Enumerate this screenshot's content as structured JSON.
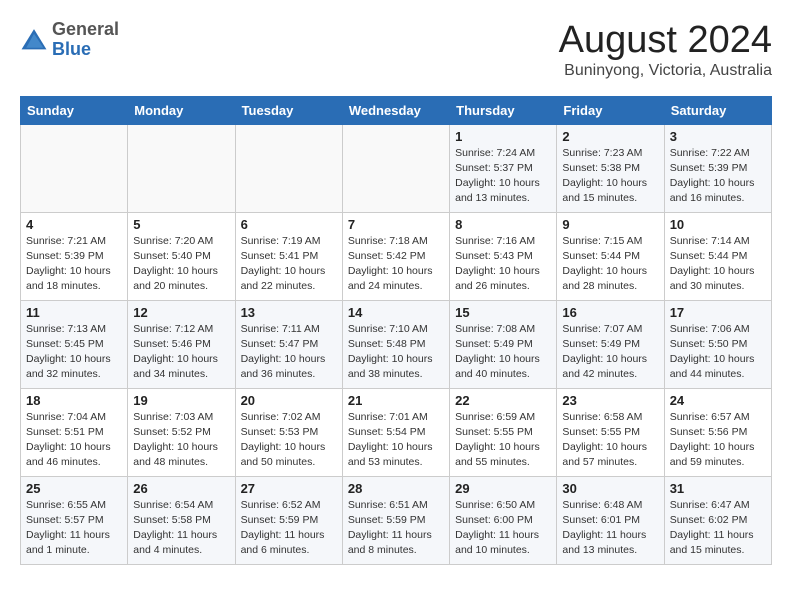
{
  "header": {
    "logo_general": "General",
    "logo_blue": "Blue",
    "title": "August 2024",
    "subtitle": "Buninyong, Victoria, Australia"
  },
  "days_of_week": [
    "Sunday",
    "Monday",
    "Tuesday",
    "Wednesday",
    "Thursday",
    "Friday",
    "Saturday"
  ],
  "weeks": [
    [
      {
        "day": "",
        "info": ""
      },
      {
        "day": "",
        "info": ""
      },
      {
        "day": "",
        "info": ""
      },
      {
        "day": "",
        "info": ""
      },
      {
        "day": "1",
        "info": "Sunrise: 7:24 AM\nSunset: 5:37 PM\nDaylight: 10 hours\nand 13 minutes."
      },
      {
        "day": "2",
        "info": "Sunrise: 7:23 AM\nSunset: 5:38 PM\nDaylight: 10 hours\nand 15 minutes."
      },
      {
        "day": "3",
        "info": "Sunrise: 7:22 AM\nSunset: 5:39 PM\nDaylight: 10 hours\nand 16 minutes."
      }
    ],
    [
      {
        "day": "4",
        "info": "Sunrise: 7:21 AM\nSunset: 5:39 PM\nDaylight: 10 hours\nand 18 minutes."
      },
      {
        "day": "5",
        "info": "Sunrise: 7:20 AM\nSunset: 5:40 PM\nDaylight: 10 hours\nand 20 minutes."
      },
      {
        "day": "6",
        "info": "Sunrise: 7:19 AM\nSunset: 5:41 PM\nDaylight: 10 hours\nand 22 minutes."
      },
      {
        "day": "7",
        "info": "Sunrise: 7:18 AM\nSunset: 5:42 PM\nDaylight: 10 hours\nand 24 minutes."
      },
      {
        "day": "8",
        "info": "Sunrise: 7:16 AM\nSunset: 5:43 PM\nDaylight: 10 hours\nand 26 minutes."
      },
      {
        "day": "9",
        "info": "Sunrise: 7:15 AM\nSunset: 5:44 PM\nDaylight: 10 hours\nand 28 minutes."
      },
      {
        "day": "10",
        "info": "Sunrise: 7:14 AM\nSunset: 5:44 PM\nDaylight: 10 hours\nand 30 minutes."
      }
    ],
    [
      {
        "day": "11",
        "info": "Sunrise: 7:13 AM\nSunset: 5:45 PM\nDaylight: 10 hours\nand 32 minutes."
      },
      {
        "day": "12",
        "info": "Sunrise: 7:12 AM\nSunset: 5:46 PM\nDaylight: 10 hours\nand 34 minutes."
      },
      {
        "day": "13",
        "info": "Sunrise: 7:11 AM\nSunset: 5:47 PM\nDaylight: 10 hours\nand 36 minutes."
      },
      {
        "day": "14",
        "info": "Sunrise: 7:10 AM\nSunset: 5:48 PM\nDaylight: 10 hours\nand 38 minutes."
      },
      {
        "day": "15",
        "info": "Sunrise: 7:08 AM\nSunset: 5:49 PM\nDaylight: 10 hours\nand 40 minutes."
      },
      {
        "day": "16",
        "info": "Sunrise: 7:07 AM\nSunset: 5:49 PM\nDaylight: 10 hours\nand 42 minutes."
      },
      {
        "day": "17",
        "info": "Sunrise: 7:06 AM\nSunset: 5:50 PM\nDaylight: 10 hours\nand 44 minutes."
      }
    ],
    [
      {
        "day": "18",
        "info": "Sunrise: 7:04 AM\nSunset: 5:51 PM\nDaylight: 10 hours\nand 46 minutes."
      },
      {
        "day": "19",
        "info": "Sunrise: 7:03 AM\nSunset: 5:52 PM\nDaylight: 10 hours\nand 48 minutes."
      },
      {
        "day": "20",
        "info": "Sunrise: 7:02 AM\nSunset: 5:53 PM\nDaylight: 10 hours\nand 50 minutes."
      },
      {
        "day": "21",
        "info": "Sunrise: 7:01 AM\nSunset: 5:54 PM\nDaylight: 10 hours\nand 53 minutes."
      },
      {
        "day": "22",
        "info": "Sunrise: 6:59 AM\nSunset: 5:55 PM\nDaylight: 10 hours\nand 55 minutes."
      },
      {
        "day": "23",
        "info": "Sunrise: 6:58 AM\nSunset: 5:55 PM\nDaylight: 10 hours\nand 57 minutes."
      },
      {
        "day": "24",
        "info": "Sunrise: 6:57 AM\nSunset: 5:56 PM\nDaylight: 10 hours\nand 59 minutes."
      }
    ],
    [
      {
        "day": "25",
        "info": "Sunrise: 6:55 AM\nSunset: 5:57 PM\nDaylight: 11 hours\nand 1 minute."
      },
      {
        "day": "26",
        "info": "Sunrise: 6:54 AM\nSunset: 5:58 PM\nDaylight: 11 hours\nand 4 minutes."
      },
      {
        "day": "27",
        "info": "Sunrise: 6:52 AM\nSunset: 5:59 PM\nDaylight: 11 hours\nand 6 minutes."
      },
      {
        "day": "28",
        "info": "Sunrise: 6:51 AM\nSunset: 5:59 PM\nDaylight: 11 hours\nand 8 minutes."
      },
      {
        "day": "29",
        "info": "Sunrise: 6:50 AM\nSunset: 6:00 PM\nDaylight: 11 hours\nand 10 minutes."
      },
      {
        "day": "30",
        "info": "Sunrise: 6:48 AM\nSunset: 6:01 PM\nDaylight: 11 hours\nand 13 minutes."
      },
      {
        "day": "31",
        "info": "Sunrise: 6:47 AM\nSunset: 6:02 PM\nDaylight: 11 hours\nand 15 minutes."
      }
    ]
  ]
}
